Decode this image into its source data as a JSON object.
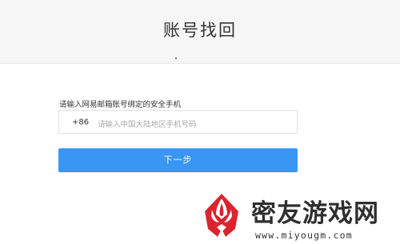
{
  "header": {
    "title": "账号找回"
  },
  "form": {
    "phone_label": "请输入网易邮箱账号绑定的安全手机",
    "country_code": "+86",
    "phone_placeholder": "请输入中国大陆地区手机号码",
    "next_button_label": "下一步"
  },
  "watermark": {
    "site_name": "密友游戏网",
    "url": "www.miyougm.com",
    "logo_icon": "red-flower-logo-icon",
    "logo_color": "#d9232d"
  },
  "colors": {
    "primary_button": "#3a96f3",
    "header_background": "#f6f6f6"
  }
}
